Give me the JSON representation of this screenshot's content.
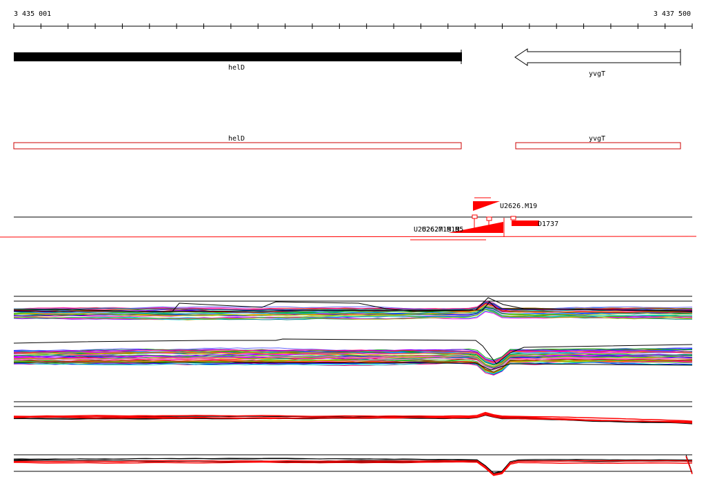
{
  "header": {
    "coord_start": "3 435 001",
    "coord_end": "3 437 500"
  },
  "genes": [
    {
      "name": "helD",
      "strand": "+"
    },
    {
      "name": "yvgT",
      "strand": "-"
    }
  ],
  "gene_outline_labels": [
    "helD",
    "yvgT"
  ],
  "features": {
    "upper_label": "U2626.M19",
    "right_label": "D1737",
    "overlapping_label": "U2626.M19 M5",
    "overlapping_label_2": "U2627.M19"
  },
  "colors": {
    "gene_fill": "#000000",
    "outline": "#cc0000",
    "feature_red": "#ff0000",
    "axis": "#000000"
  },
  "track_groups": [
    {
      "id": "group-1",
      "style": "multicolor",
      "dip_region": "small-bump"
    },
    {
      "id": "group-2",
      "style": "multicolor",
      "dip_region": "dip"
    },
    {
      "id": "group-3",
      "style": "black-red",
      "dip_region": "small-bump"
    },
    {
      "id": "group-4",
      "style": "black-red",
      "dip_region": "dip"
    }
  ]
}
